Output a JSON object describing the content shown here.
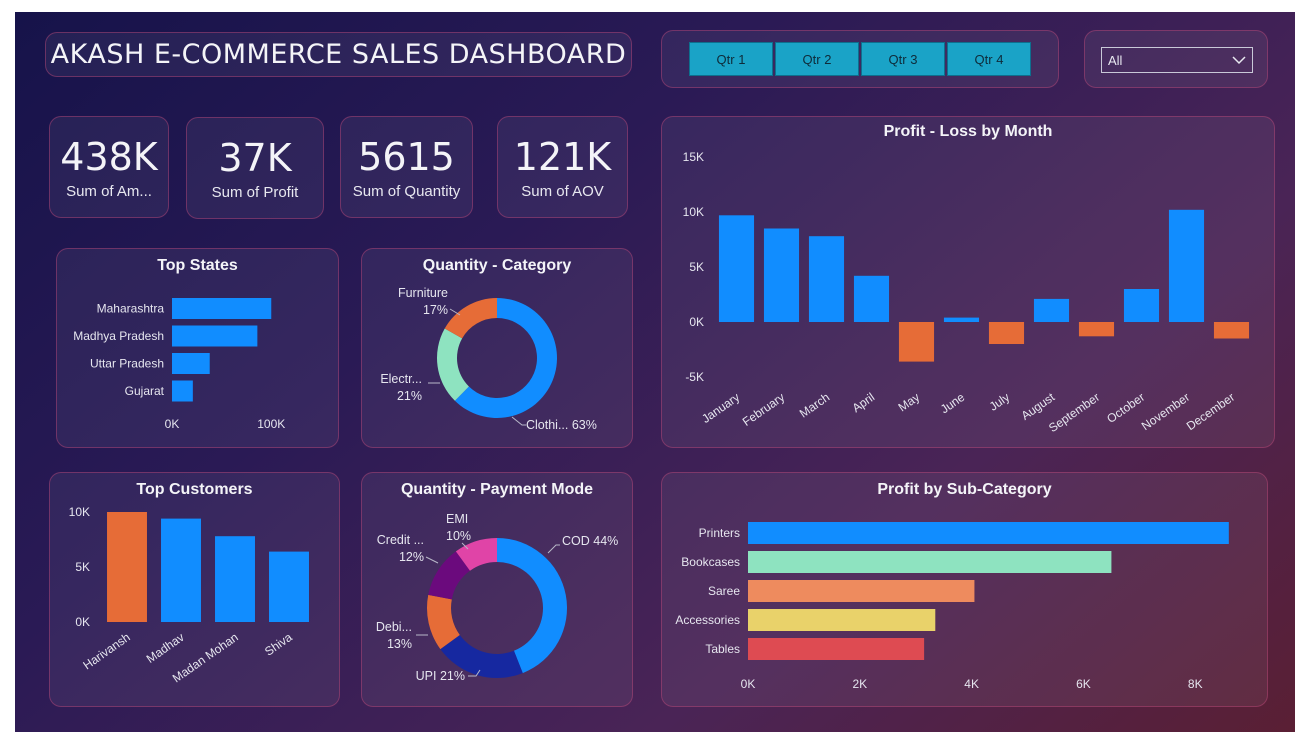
{
  "dashboard": {
    "title": "AKASH E-COMMERCE SALES DASHBOARD",
    "quarter_buttons": [
      "Qtr 1",
      "Qtr 2",
      "Qtr 3",
      "Qtr 4"
    ],
    "filter_dropdown": {
      "value": "All",
      "icon": "chevron-down-icon"
    }
  },
  "kpis": [
    {
      "value": "438K",
      "label": "Sum of Am..."
    },
    {
      "value": "37K",
      "label": "Sum of Profit"
    },
    {
      "value": "5615",
      "label": "Sum of Quantity"
    },
    {
      "value": "121K",
      "label": "Sum of AOV"
    }
  ],
  "colors": {
    "blue": "#118dff",
    "orange": "#e66c37",
    "mint": "#8ee3c0",
    "salmon": "#ee8b5e",
    "yellow": "#e9d26a",
    "red": "#de4b52",
    "navy": "#1628a0",
    "purple": "#6b0a7d",
    "magenta": "#e044a7"
  },
  "chart_data": [
    {
      "id": "top-states",
      "type": "bar",
      "orientation": "horizontal",
      "title": "Top States",
      "categories": [
        "Maharashtra",
        "Madhya Pradesh",
        "Uttar Pradesh",
        "Gujarat"
      ],
      "values": [
        100000,
        86000,
        38000,
        21000
      ],
      "ticks": [
        0,
        100000
      ],
      "tick_labels": [
        "0K",
        "100K"
      ],
      "xlim": [
        0,
        135000
      ]
    },
    {
      "id": "quantity-category",
      "type": "pie",
      "title": "Quantity - Category",
      "slices": [
        {
          "label": "Clothi...",
          "percent": "63%",
          "value": 63,
          "color": "#118dff"
        },
        {
          "label": "Electr...",
          "percent": "21%",
          "value": 21,
          "color": "#8ee3c0"
        },
        {
          "label": "Furniture",
          "percent": "17%",
          "value": 17,
          "color": "#e66c37"
        }
      ]
    },
    {
      "id": "profit-loss-by-month",
      "type": "bar",
      "title": "Profit - Loss by Month",
      "categories": [
        "January",
        "February",
        "March",
        "April",
        "May",
        "June",
        "July",
        "August",
        "September",
        "October",
        "November",
        "December"
      ],
      "values": [
        9700,
        8500,
        7800,
        4200,
        -3600,
        400,
        -2000,
        2100,
        -1300,
        3000,
        10200,
        -1500
      ],
      "ylim": [
        -5000,
        15000
      ],
      "ticks": [
        -5000,
        0,
        5000,
        10000,
        15000
      ],
      "tick_labels": [
        "-5K",
        "0K",
        "5K",
        "10K",
        "15K"
      ],
      "positive_color": "#118dff",
      "negative_color": "#e66c37"
    },
    {
      "id": "top-customers",
      "type": "bar",
      "title": "Top Customers",
      "categories": [
        "Harivansh",
        "Madhav",
        "Madan Mohan",
        "Shiva"
      ],
      "values": [
        10000,
        9400,
        7800,
        6400
      ],
      "ylim": [
        0,
        10000
      ],
      "ticks": [
        0,
        5000,
        10000
      ],
      "tick_labels": [
        "0K",
        "5K",
        "10K"
      ],
      "bar_colors": [
        "#e66c37",
        "#118dff",
        "#118dff",
        "#118dff"
      ]
    },
    {
      "id": "quantity-payment-mode",
      "type": "pie",
      "title": "Quantity - Payment Mode",
      "slices": [
        {
          "label": "COD",
          "percent": "44%",
          "value": 44,
          "color": "#118dff"
        },
        {
          "label": "UPI",
          "percent": "21%",
          "value": 21,
          "color": "#1628a0"
        },
        {
          "label": "Debi...",
          "percent": "13%",
          "value": 13,
          "color": "#e66c37"
        },
        {
          "label": "Credit ...",
          "percent": "12%",
          "value": 12,
          "color": "#6b0a7d"
        },
        {
          "label": "EMI",
          "percent": "10%",
          "value": 10,
          "color": "#e044a7"
        }
      ]
    },
    {
      "id": "profit-by-subcategory",
      "type": "bar",
      "orientation": "horizontal",
      "title": "Profit by Sub-Category",
      "categories": [
        "Printers",
        "Bookcases",
        "Saree",
        "Accessories",
        "Tables"
      ],
      "values": [
        8600,
        6500,
        4050,
        3350,
        3150
      ],
      "bar_colors": [
        "#118dff",
        "#8ee3c0",
        "#ee8b5e",
        "#e9d26a",
        "#de4b52"
      ],
      "xlim": [
        0,
        8800
      ],
      "ticks": [
        0,
        2000,
        4000,
        6000,
        8000
      ],
      "tick_labels": [
        "0K",
        "2K",
        "4K",
        "6K",
        "8K"
      ]
    }
  ]
}
